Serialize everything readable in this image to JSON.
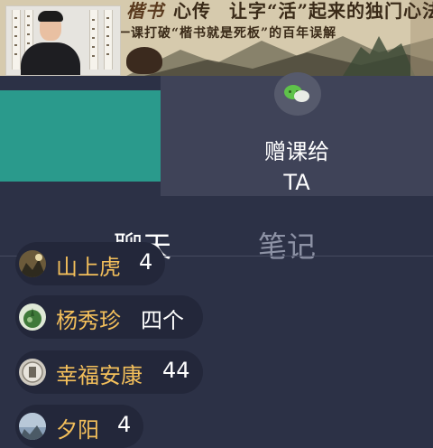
{
  "banner": {
    "title_brush": "楷书",
    "title_rest": "心传",
    "title_tagline": "让字“活”起来的独门心法",
    "subtitle": "一课打破“楷书就是死板”的百年误解"
  },
  "gift": {
    "label": "赠课给",
    "target": "TA"
  },
  "tabs": {
    "chat": "聊天",
    "notes": "笔记"
  },
  "messages": [
    {
      "name": "山上虎",
      "text": "4",
      "avatar_color": "#6b5a3a"
    },
    {
      "name": "杨秀珍",
      "text": "四个",
      "avatar_color": "#3f7a3a"
    },
    {
      "name": "幸福安康",
      "text": "44",
      "avatar_color": "#cfcac0"
    },
    {
      "name": "夕阳",
      "text": "4",
      "avatar_color": "#8aa0b8"
    }
  ],
  "colors": {
    "background": "#2c3146",
    "teal_panel": "#2a9a8c",
    "name": "#f3bf5b",
    "wechat": "#5fc24a"
  }
}
